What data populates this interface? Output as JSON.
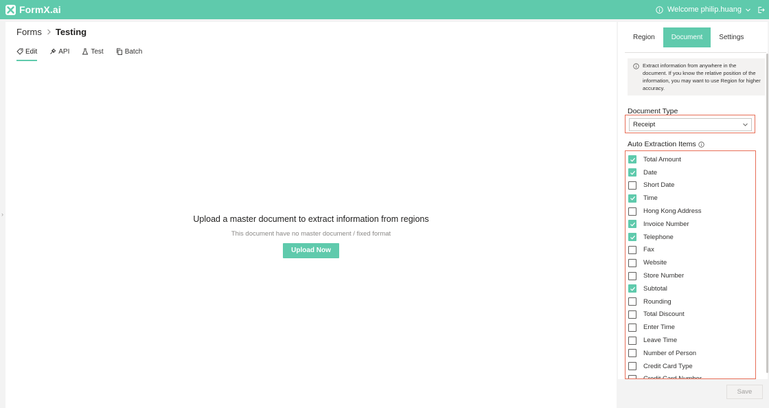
{
  "app": {
    "logo_text": "FormX.ai",
    "welcome": "Welcome philip.huang"
  },
  "breadcrumb": {
    "root": "Forms",
    "current": "Testing"
  },
  "tabs": [
    {
      "label": "Edit",
      "icon": "tag-icon",
      "active": true
    },
    {
      "label": "API",
      "icon": "plug-icon",
      "active": false
    },
    {
      "label": "Test",
      "icon": "flask-icon",
      "active": false
    },
    {
      "label": "Batch",
      "icon": "copy-icon",
      "active": false
    }
  ],
  "empty_state": {
    "title": "Upload a master document to extract information from regions",
    "subtitle": "This document have no master document / fixed format",
    "button": "Upload Now"
  },
  "panel": {
    "tabs": [
      {
        "label": "Region",
        "active": false
      },
      {
        "label": "Document",
        "active": true
      },
      {
        "label": "Settings",
        "active": false
      }
    ],
    "notice": "Extract information from anywhere in the document. If you know the relative position of the information, you may want to use Region for higher accuracy.",
    "document_type_label": "Document Type",
    "document_type_value": "Receipt",
    "auto_extraction_label": "Auto Extraction Items",
    "items": [
      {
        "label": "Total Amount",
        "checked": true
      },
      {
        "label": "Date",
        "checked": true
      },
      {
        "label": "Short Date",
        "checked": false
      },
      {
        "label": "Time",
        "checked": true
      },
      {
        "label": "Hong Kong Address",
        "checked": false
      },
      {
        "label": "Invoice Number",
        "checked": true
      },
      {
        "label": "Telephone",
        "checked": true
      },
      {
        "label": "Fax",
        "checked": false
      },
      {
        "label": "Website",
        "checked": false
      },
      {
        "label": "Store Number",
        "checked": false
      },
      {
        "label": "Subtotal",
        "checked": true
      },
      {
        "label": "Rounding",
        "checked": false
      },
      {
        "label": "Total Discount",
        "checked": false
      },
      {
        "label": "Enter Time",
        "checked": false
      },
      {
        "label": "Leave Time",
        "checked": false
      },
      {
        "label": "Number of Person",
        "checked": false
      },
      {
        "label": "Credit Card Type",
        "checked": false
      },
      {
        "label": "Credit Card Number",
        "checked": false
      }
    ],
    "save_label": "Save"
  },
  "colors": {
    "accent": "#5fcaac",
    "highlight_border": "#e76e57"
  }
}
